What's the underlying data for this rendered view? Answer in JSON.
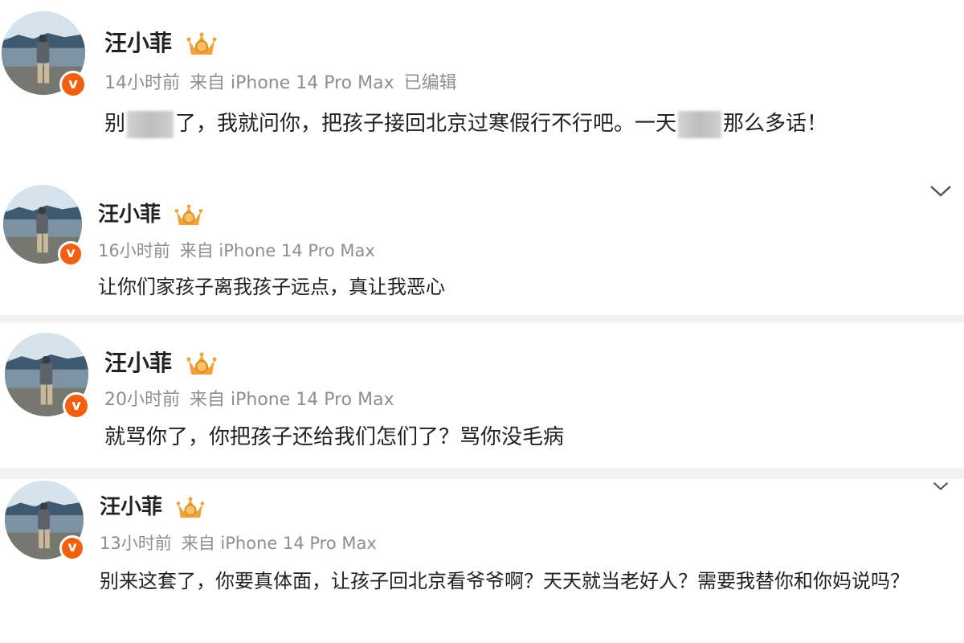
{
  "posts": [
    {
      "name": "汪小菲",
      "time": "14小时前",
      "source": "来自 iPhone 14 Pro Max",
      "edited": "已编辑",
      "text_parts": [
        "别",
        "了，我就问你，把孩子接回北京过寒假行不行吧。一天",
        "那么多话！"
      ]
    },
    {
      "name": "汪小菲",
      "time": "16小时前",
      "source": "来自 iPhone 14 Pro Max",
      "text": "让你们家孩子离我孩子远点，真让我恶心"
    },
    {
      "name": "汪小菲",
      "time": "20小时前",
      "source": "来自 iPhone 14 Pro Max",
      "text": "就骂你了，你把孩子还给我们怎们了？骂你没毛病"
    },
    {
      "name": "汪小菲",
      "time": "13小时前",
      "source": "来自 iPhone 14 Pro Max",
      "text": "别来这套了，你要真体面，让孩子回北京看爷爷啊？天天就当老好人？需要我替你和你妈说吗？"
    }
  ],
  "badge": {
    "verified_letter": "v",
    "verified_color": "#f25f0e",
    "crown_color": "#f2a23a"
  },
  "icons": {
    "expand": "chevron-down-icon",
    "verified": "verified-badge-icon",
    "crown": "crown-medal-icon"
  }
}
